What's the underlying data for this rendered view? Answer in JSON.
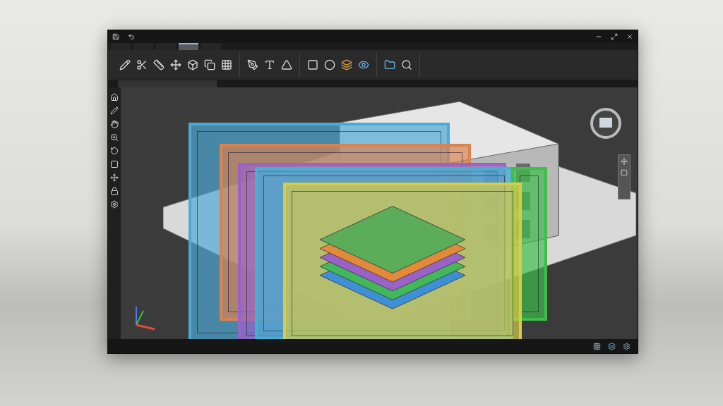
{
  "ribbon_tabs": [
    {
      "selected": false
    },
    {
      "selected": false
    },
    {
      "selected": false
    },
    {
      "selected": true
    },
    {
      "selected": false
    }
  ],
  "sheets": [
    {
      "color": "#4fa9d8"
    },
    {
      "color": "#d9834f"
    },
    {
      "color": "#9a62c9"
    },
    {
      "color": "#3fb3d0"
    },
    {
      "color": "#3fbf4a"
    },
    {
      "color": "#d9cc45"
    }
  ]
}
